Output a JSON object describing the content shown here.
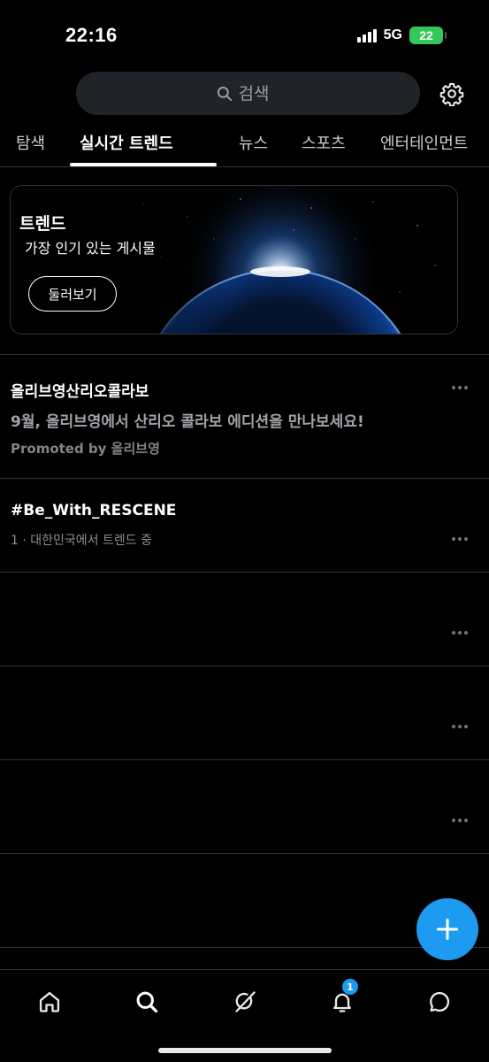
{
  "status_bar": {
    "time": "22:16",
    "network": "5G",
    "battery": "22"
  },
  "header": {
    "search_placeholder": "검색",
    "settings_icon": "gear-icon"
  },
  "tabs": [
    {
      "label": "탐색"
    },
    {
      "label": "실시간 트렌드",
      "active": true
    },
    {
      "label": "뉴스"
    },
    {
      "label": "스포츠"
    },
    {
      "label": "엔터테인먼트"
    }
  ],
  "hero": {
    "title": "트렌드",
    "subtitle": "가장 인기 있는 게시물",
    "button_label": "둘러보기"
  },
  "trends": [
    {
      "title": "올리브영산리오콜라보",
      "description": "9월, 올리브영에서 산리오 콜라보 에디션을 만나보세요!",
      "promoted": "Promoted by 올리브영"
    },
    {
      "title": "#Be_With_RESCENE",
      "meta": "1 · 대한민국에서 트렌드 중"
    },
    {
      "title": "",
      "meta": ""
    },
    {
      "title": "",
      "meta": ""
    },
    {
      "title": "",
      "meta": ""
    },
    {
      "title": "",
      "meta": ""
    }
  ],
  "fab": {
    "icon": "plus-icon"
  },
  "bottom_nav": {
    "items": [
      {
        "icon": "home-icon"
      },
      {
        "icon": "search-icon"
      },
      {
        "icon": "grok-icon"
      },
      {
        "icon": "bell-icon",
        "badge": "1"
      },
      {
        "icon": "message-icon"
      }
    ]
  },
  "colors": {
    "accent": "#1d9bf0",
    "background": "#000000",
    "divider": "#2f3336",
    "battery": "#34c759"
  }
}
